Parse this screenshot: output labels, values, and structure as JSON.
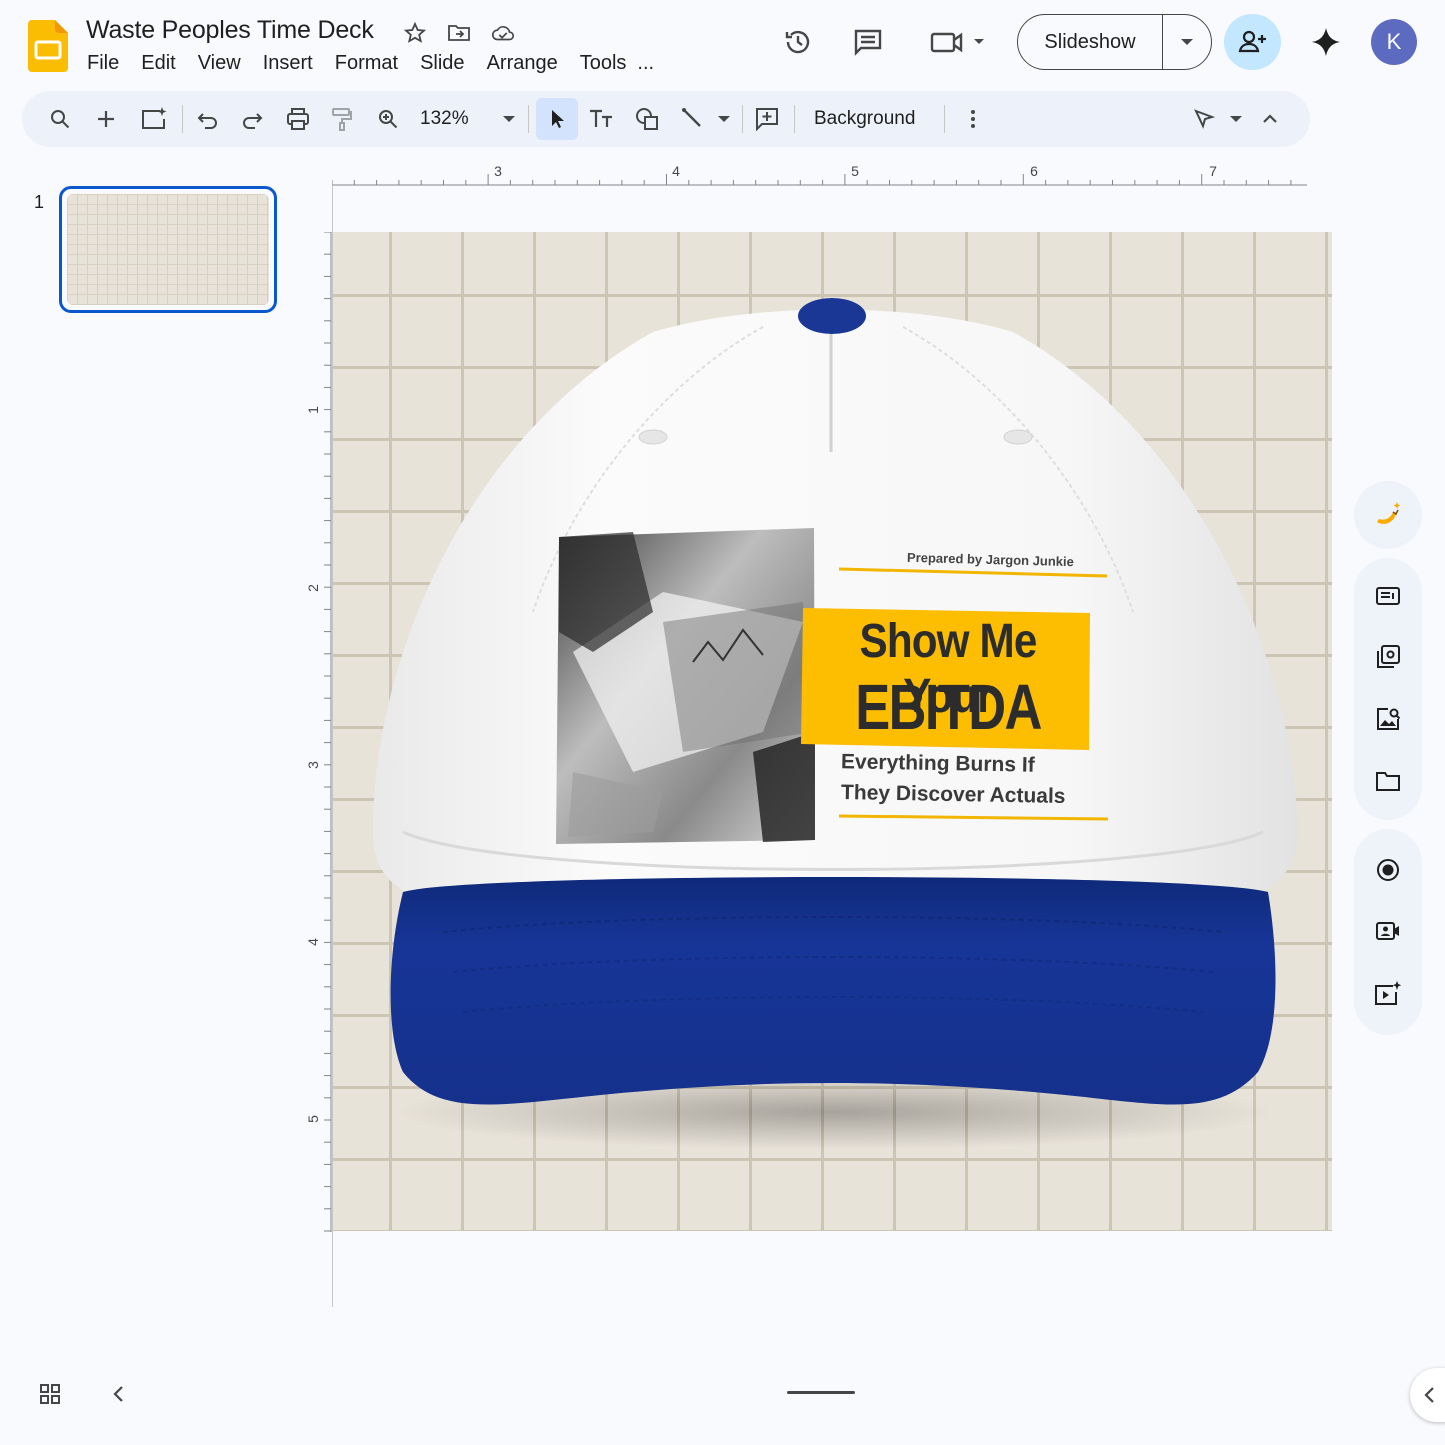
{
  "app": {
    "title": "Waste Peoples Time Deck"
  },
  "menus": [
    "File",
    "Edit",
    "View",
    "Insert",
    "Format",
    "Slide",
    "Arrange",
    "Tools",
    "..."
  ],
  "header": {
    "slideshow_label": "Slideshow",
    "avatar_initial": "K"
  },
  "toolbar": {
    "zoom": "132%",
    "background_label": "Background"
  },
  "filmstrip": {
    "slide_number": "1"
  },
  "rulers": {
    "horizontal": [
      "3",
      "4",
      "5",
      "6",
      "7"
    ],
    "vertical": [
      "1",
      "2",
      "3",
      "4",
      "5"
    ]
  },
  "slide": {
    "prepared_by": "Prepared by Jargon Junkie",
    "headline_line1": "Show Me Your",
    "headline_line2": "EBITDA",
    "subtitle_line1": "Everything Burns If",
    "subtitle_line2": "They Discover Actuals"
  },
  "colors": {
    "accent_blue": "#0b57d0",
    "cap_blue": "#163593",
    "label_yellow": "#fdbd00",
    "canvas": "#e8e3d9"
  },
  "icons": {
    "header": [
      "version-history-icon",
      "comments-icon",
      "meet-camera-icon",
      "share-person-add-icon",
      "gemini-spark-icon"
    ],
    "side_panel": [
      "banana-ai-icon",
      "layout-icon",
      "slides-library-icon",
      "image-search-icon",
      "folder-icon",
      "record-icon",
      "camera-record-icon",
      "video-add-icon"
    ]
  }
}
